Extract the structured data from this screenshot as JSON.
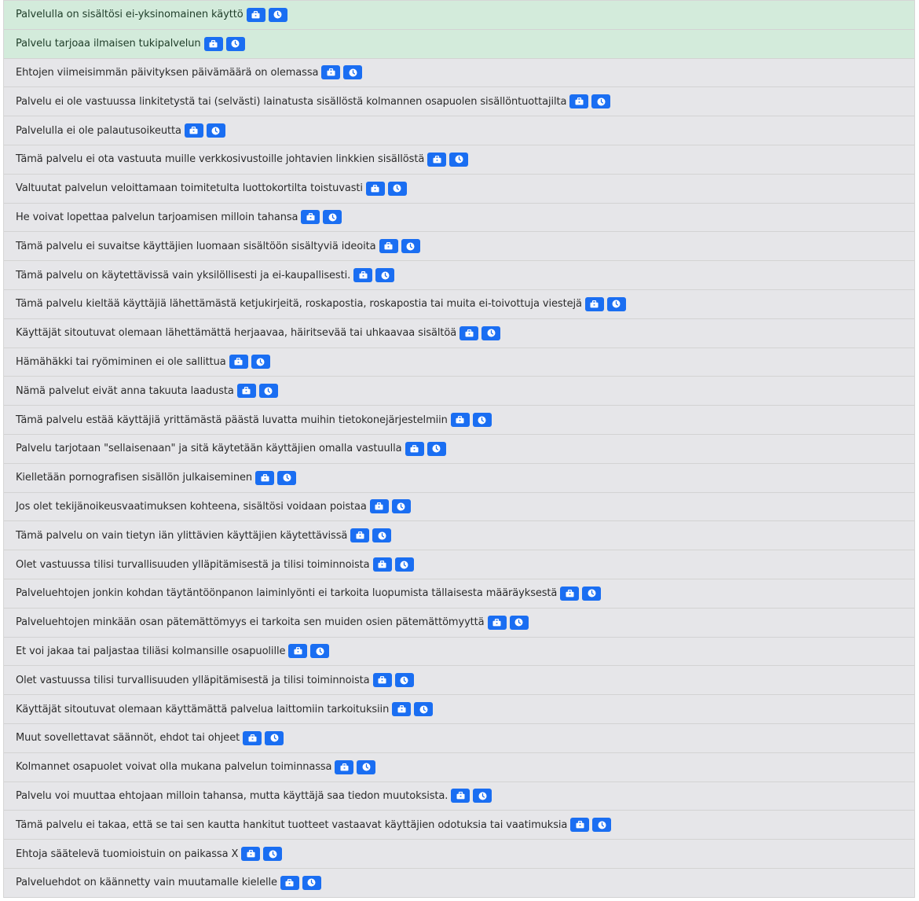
{
  "colors": {
    "good_row_bg": "#d3ebdb",
    "neutral_row_bg": "#e6e6e9",
    "badge_bg": "#1a6ef2"
  },
  "icons": {
    "first": "briefcase-icon",
    "second": "clock-icon"
  },
  "rows": [
    {
      "text": "Palvelulla on sisältösi ei-yksinomainen käyttö",
      "type": "good"
    },
    {
      "text": "Palvelu tarjoaa ilmaisen tukipalvelun",
      "type": "good"
    },
    {
      "text": "Ehtojen viimeisimmän päivityksen päivämäärä on olemassa",
      "type": "neutral"
    },
    {
      "text": "Palvelu ei ole vastuussa linkitetystä tai (selvästi) lainatusta sisällöstä kolmannen osapuolen sisällöntuottajilta",
      "type": "neutral"
    },
    {
      "text": "Palvelulla ei ole palautusoikeutta",
      "type": "neutral"
    },
    {
      "text": "Tämä palvelu ei ota vastuuta muille verkkosivustoille johtavien linkkien sisällöstä",
      "type": "neutral"
    },
    {
      "text": "Valtuutat palvelun veloittamaan toimitetulta luottokortilta toistuvasti",
      "type": "neutral"
    },
    {
      "text": "He voivat lopettaa palvelun tarjoamisen milloin tahansa",
      "type": "neutral"
    },
    {
      "text": "Tämä palvelu ei suvaitse käyttäjien luomaan sisältöön sisältyviä ideoita",
      "type": "neutral"
    },
    {
      "text": "Tämä palvelu on käytettävissä vain yksilöllisesti ja ei-kaupallisesti.",
      "type": "neutral"
    },
    {
      "text": "Tämä palvelu kieltää käyttäjiä lähettämästä ketjukirjeitä, roskapostia, roskapostia tai muita ei-toivottuja viestejä",
      "type": "neutral"
    },
    {
      "text": "Käyttäjät sitoutuvat olemaan lähettämättä herjaavaa, häiritsevää tai uhkaavaa sisältöä",
      "type": "neutral"
    },
    {
      "text": "Hämähäkki tai ryömiminen ei ole sallittua",
      "type": "neutral"
    },
    {
      "text": "Nämä palvelut eivät anna takuuta laadusta",
      "type": "neutral"
    },
    {
      "text": "Tämä palvelu estää käyttäjiä yrittämästä päästä luvatta muihin tietokonejärjestelmiin",
      "type": "neutral"
    },
    {
      "text": "Palvelu tarjotaan \"sellaisenaan\" ja sitä käytetään käyttäjien omalla vastuulla",
      "type": "neutral"
    },
    {
      "text": "Kielletään pornografisen sisällön julkaiseminen",
      "type": "neutral"
    },
    {
      "text": "Jos olet tekijänoikeusvaatimuksen kohteena, sisältösi voidaan poistaa",
      "type": "neutral"
    },
    {
      "text": "Tämä palvelu on vain tietyn iän ylittävien käyttäjien käytettävissä",
      "type": "neutral"
    },
    {
      "text": "Olet vastuussa tilisi turvallisuuden ylläpitämisestä ja tilisi toiminnoista",
      "type": "neutral"
    },
    {
      "text": "Palveluehtojen jonkin kohdan täytäntöönpanon laiminlyönti ei tarkoita luopumista tällaisesta määräyksestä",
      "type": "neutral"
    },
    {
      "text": "Palveluehtojen minkään osan pätemättömyys ei tarkoita sen muiden osien pätemättömyyttä",
      "type": "neutral"
    },
    {
      "text": "Et voi jakaa tai paljastaa tiliäsi kolmansille osapuolille",
      "type": "neutral"
    },
    {
      "text": "Olet vastuussa tilisi turvallisuuden ylläpitämisestä ja tilisi toiminnoista",
      "type": "neutral"
    },
    {
      "text": "Käyttäjät sitoutuvat olemaan käyttämättä palvelua laittomiin tarkoituksiin",
      "type": "neutral"
    },
    {
      "text": "Muut sovellettavat säännöt, ehdot tai ohjeet",
      "type": "neutral"
    },
    {
      "text": "Kolmannet osapuolet voivat olla mukana palvelun toiminnassa",
      "type": "neutral"
    },
    {
      "text": "Palvelu voi muuttaa ehtojaan milloin tahansa, mutta käyttäjä saa tiedon muutoksista.",
      "type": "neutral"
    },
    {
      "text": "Tämä palvelu ei takaa, että se tai sen kautta hankitut tuotteet vastaavat käyttäjien odotuksia tai vaatimuksia",
      "type": "neutral"
    },
    {
      "text": "Ehtoja säätelevä tuomioistuin on paikassa X",
      "type": "neutral"
    },
    {
      "text": "Palveluehdot on käännetty vain muutamalle kielelle",
      "type": "neutral"
    }
  ]
}
